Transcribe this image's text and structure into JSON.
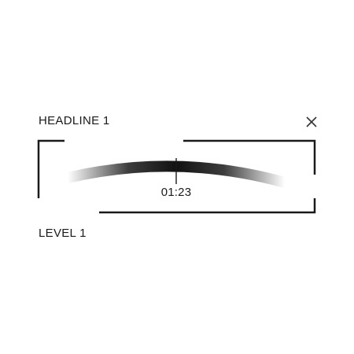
{
  "header": {
    "title": "HEADLINE 1"
  },
  "footer": {
    "level_label": "LEVEL 1"
  },
  "timeline": {
    "current_time": "01:23"
  },
  "colors": {
    "ink": "#1a1a1a",
    "background": "#ffffff"
  },
  "icons": {
    "close": "close-icon"
  }
}
